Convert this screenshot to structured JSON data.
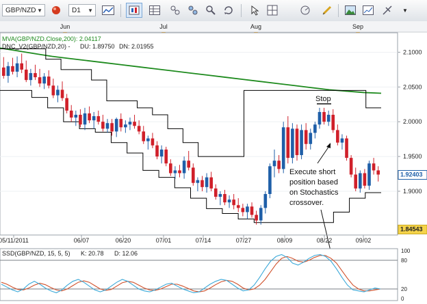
{
  "toolbar": {
    "symbol": "GBP/NZD",
    "timeframe": "D1",
    "icons": [
      "ball-icon",
      "line-chart-icon",
      "chart-type-icon",
      "table-icon",
      "indicators-icon",
      "objects-icon",
      "zoom-icon",
      "refresh-icon",
      "arrow-icon",
      "grid-icon",
      "ruler-icon",
      "image-icon",
      "settings-icon",
      "more-icon"
    ]
  },
  "colors": {
    "background": "#ffffff",
    "bull": "#1f5fa8",
    "bear": "#d0202a",
    "mva": "#1d8a1d",
    "dnc": "#000000",
    "stoch_k": "#3aa8d8",
    "stoch_d": "#d0502a"
  },
  "chart_data": {
    "type": "candlestick",
    "months": [
      "Jun",
      "Jul",
      "Aug",
      "Sep"
    ],
    "legend": {
      "mva": "MVA(GBP/NZD.Close,200): 2.04117",
      "dnc_name": "DNC_V2(GBP/NZD,20) -",
      "dnc_du": "DU: 1.89750",
      "dnc_dn": "DN: 2.01955"
    },
    "price_axis": {
      "ticks": [
        "2.1000",
        "2.0500",
        "2.0000",
        "1.9500",
        "1.9000"
      ],
      "tick_values": [
        2.1,
        2.05,
        2.0,
        1.95,
        1.9
      ],
      "ylim": [
        1.84,
        2.125
      ],
      "last_price": "1.92403",
      "low_price": "1.84543"
    },
    "date_axis": [
      "05/11/2011",
      "06/07",
      "06/20",
      "07/01",
      "07/14",
      "07/27",
      "08/09",
      "08/22",
      "09/02"
    ],
    "annotations": {
      "stop": "Stop",
      "note": [
        "Execute short",
        "position based",
        "on Stochastics",
        "crossover."
      ]
    },
    "stochastic": {
      "legend": "SSD(GBP/NZD, 15, 5, 5)",
      "k": "K: 20.78",
      "d": "D: 12.06",
      "ticks": [
        "100",
        "80",
        "20",
        "0"
      ],
      "tick_values": [
        100,
        80,
        20,
        0
      ],
      "ylim": [
        0,
        100
      ]
    },
    "candles": [
      {
        "o": 2.078,
        "h": 2.093,
        "l": 2.062,
        "c": 2.066
      },
      {
        "o": 2.066,
        "h": 2.086,
        "l": 2.056,
        "c": 2.08
      },
      {
        "o": 2.08,
        "h": 2.092,
        "l": 2.068,
        "c": 2.072
      },
      {
        "o": 2.072,
        "h": 2.094,
        "l": 2.064,
        "c": 2.084
      },
      {
        "o": 2.084,
        "h": 2.098,
        "l": 2.07,
        "c": 2.075
      },
      {
        "o": 2.075,
        "h": 2.088,
        "l": 2.057,
        "c": 2.06
      },
      {
        "o": 2.06,
        "h": 2.076,
        "l": 2.052,
        "c": 2.07
      },
      {
        "o": 2.07,
        "h": 2.082,
        "l": 2.06,
        "c": 2.064
      },
      {
        "o": 2.064,
        "h": 2.076,
        "l": 2.05,
        "c": 2.055
      },
      {
        "o": 2.055,
        "h": 2.07,
        "l": 2.047,
        "c": 2.065
      },
      {
        "o": 2.065,
        "h": 2.074,
        "l": 2.048,
        "c": 2.052
      },
      {
        "o": 2.052,
        "h": 2.062,
        "l": 2.034,
        "c": 2.038
      },
      {
        "o": 2.038,
        "h": 2.052,
        "l": 2.028,
        "c": 2.046
      },
      {
        "o": 2.046,
        "h": 2.058,
        "l": 2.03,
        "c": 2.034
      },
      {
        "o": 2.034,
        "h": 2.04,
        "l": 2.012,
        "c": 2.016
      },
      {
        "o": 2.016,
        "h": 2.024,
        "l": 2.0,
        "c": 2.006
      },
      {
        "o": 2.006,
        "h": 2.016,
        "l": 1.994,
        "c": 2.01
      },
      {
        "o": 2.01,
        "h": 2.018,
        "l": 1.992,
        "c": 1.996
      },
      {
        "o": 1.996,
        "h": 2.02,
        "l": 1.988,
        "c": 2.012
      },
      {
        "o": 2.012,
        "h": 2.022,
        "l": 1.998,
        "c": 2.002
      },
      {
        "o": 2.002,
        "h": 2.014,
        "l": 1.99,
        "c": 2.008
      },
      {
        "o": 2.008,
        "h": 2.016,
        "l": 1.996,
        "c": 2.0
      },
      {
        "o": 2.0,
        "h": 2.01,
        "l": 1.986,
        "c": 1.99
      },
      {
        "o": 1.99,
        "h": 2.004,
        "l": 1.984,
        "c": 1.998
      },
      {
        "o": 1.998,
        "h": 2.004,
        "l": 1.98,
        "c": 1.986
      },
      {
        "o": 1.986,
        "h": 2.006,
        "l": 1.978,
        "c": 2.004
      },
      {
        "o": 2.004,
        "h": 2.012,
        "l": 1.986,
        "c": 1.992
      },
      {
        "o": 1.992,
        "h": 2.002,
        "l": 1.984,
        "c": 1.996
      },
      {
        "o": 1.996,
        "h": 2.006,
        "l": 1.988,
        "c": 2.0
      },
      {
        "o": 2.0,
        "h": 2.01,
        "l": 1.99,
        "c": 1.994
      },
      {
        "o": 1.994,
        "h": 2.002,
        "l": 1.982,
        "c": 1.986
      },
      {
        "o": 1.986,
        "h": 1.994,
        "l": 1.968,
        "c": 1.972
      },
      {
        "o": 1.972,
        "h": 1.98,
        "l": 1.96,
        "c": 1.976
      },
      {
        "o": 1.976,
        "h": 1.984,
        "l": 1.962,
        "c": 1.966
      },
      {
        "o": 1.966,
        "h": 1.972,
        "l": 1.946,
        "c": 1.95
      },
      {
        "o": 1.95,
        "h": 1.966,
        "l": 1.94,
        "c": 1.96
      },
      {
        "o": 1.96,
        "h": 1.964,
        "l": 1.936,
        "c": 1.94
      },
      {
        "o": 1.94,
        "h": 1.946,
        "l": 1.922,
        "c": 1.926
      },
      {
        "o": 1.926,
        "h": 1.936,
        "l": 1.918,
        "c": 1.93
      },
      {
        "o": 1.93,
        "h": 1.938,
        "l": 1.92,
        "c": 1.926
      },
      {
        "o": 1.926,
        "h": 1.95,
        "l": 1.918,
        "c": 1.944
      },
      {
        "o": 1.944,
        "h": 1.958,
        "l": 1.93,
        "c": 1.934
      },
      {
        "o": 1.934,
        "h": 1.94,
        "l": 1.908,
        "c": 1.912
      },
      {
        "o": 1.912,
        "h": 1.92,
        "l": 1.9,
        "c": 1.916
      },
      {
        "o": 1.916,
        "h": 1.922,
        "l": 1.9,
        "c": 1.906
      },
      {
        "o": 1.906,
        "h": 1.926,
        "l": 1.898,
        "c": 1.92
      },
      {
        "o": 1.92,
        "h": 1.928,
        "l": 1.9,
        "c": 1.904
      },
      {
        "o": 1.904,
        "h": 1.91,
        "l": 1.888,
        "c": 1.892
      },
      {
        "o": 1.892,
        "h": 1.9,
        "l": 1.88,
        "c": 1.896
      },
      {
        "o": 1.896,
        "h": 1.902,
        "l": 1.88,
        "c": 1.884
      },
      {
        "o": 1.884,
        "h": 1.894,
        "l": 1.876,
        "c": 1.888
      },
      {
        "o": 1.888,
        "h": 1.896,
        "l": 1.874,
        "c": 1.88
      },
      {
        "o": 1.88,
        "h": 1.89,
        "l": 1.87,
        "c": 1.876
      },
      {
        "o": 1.876,
        "h": 1.882,
        "l": 1.864,
        "c": 1.87
      },
      {
        "o": 1.87,
        "h": 1.882,
        "l": 1.86,
        "c": 1.878
      },
      {
        "o": 1.878,
        "h": 1.884,
        "l": 1.862,
        "c": 1.866
      },
      {
        "o": 1.866,
        "h": 1.872,
        "l": 1.852,
        "c": 1.858
      },
      {
        "o": 1.858,
        "h": 1.88,
        "l": 1.852,
        "c": 1.876
      },
      {
        "o": 1.876,
        "h": 1.9,
        "l": 1.868,
        "c": 1.896
      },
      {
        "o": 1.896,
        "h": 1.94,
        "l": 1.89,
        "c": 1.936
      },
      {
        "o": 1.936,
        "h": 1.96,
        "l": 1.92,
        "c": 1.944
      },
      {
        "o": 1.944,
        "h": 1.952,
        "l": 1.926,
        "c": 1.932
      },
      {
        "o": 1.932,
        "h": 2.0,
        "l": 1.926,
        "c": 1.992
      },
      {
        "o": 1.992,
        "h": 2.008,
        "l": 1.94,
        "c": 1.948
      },
      {
        "o": 1.948,
        "h": 1.998,
        "l": 1.94,
        "c": 1.99
      },
      {
        "o": 1.99,
        "h": 1.996,
        "l": 1.944,
        "c": 1.952
      },
      {
        "o": 1.952,
        "h": 1.996,
        "l": 1.946,
        "c": 1.988
      },
      {
        "o": 1.988,
        "h": 1.998,
        "l": 1.96,
        "c": 1.968
      },
      {
        "o": 1.968,
        "h": 1.99,
        "l": 1.96,
        "c": 1.984
      },
      {
        "o": 1.984,
        "h": 2.0,
        "l": 1.976,
        "c": 1.996
      },
      {
        "o": 1.996,
        "h": 2.02,
        "l": 1.99,
        "c": 2.014
      },
      {
        "o": 2.014,
        "h": 2.02,
        "l": 1.996,
        "c": 2.0
      },
      {
        "o": 2.0,
        "h": 2.016,
        "l": 1.994,
        "c": 2.01
      },
      {
        "o": 2.01,
        "h": 2.018,
        "l": 1.984,
        "c": 1.988
      },
      {
        "o": 1.988,
        "h": 1.996,
        "l": 1.966,
        "c": 1.97
      },
      {
        "o": 1.97,
        "h": 1.982,
        "l": 1.96,
        "c": 1.976
      },
      {
        "o": 1.976,
        "h": 1.98,
        "l": 1.944,
        "c": 1.948
      },
      {
        "o": 1.948,
        "h": 1.952,
        "l": 1.92,
        "c": 1.924
      },
      {
        "o": 1.924,
        "h": 1.934,
        "l": 1.9,
        "c": 1.904
      },
      {
        "o": 1.904,
        "h": 1.93,
        "l": 1.898,
        "c": 1.926
      },
      {
        "o": 1.926,
        "h": 1.932,
        "l": 1.904,
        "c": 1.908
      },
      {
        "o": 1.908,
        "h": 1.944,
        "l": 1.902,
        "c": 1.94
      },
      {
        "o": 1.94,
        "h": 1.948,
        "l": 1.924,
        "c": 1.93
      },
      {
        "o": 1.93,
        "h": 1.936,
        "l": 1.914,
        "c": 1.924
      }
    ],
    "mva_values": [
      2.106,
      2.102,
      2.098,
      2.094,
      2.091,
      2.088,
      2.085,
      2.082,
      2.079,
      2.076,
      2.073,
      2.07,
      2.067,
      2.064,
      2.061,
      2.058,
      2.055,
      2.052,
      2.049,
      2.046,
      2.044,
      2.042,
      2.041
    ],
    "dnc_upper": [
      2.105,
      2.105,
      2.105,
      2.09,
      2.075,
      2.075,
      2.06,
      2.03,
      2.03,
      2.02,
      2.01,
      1.99,
      1.97,
      1.95,
      1.95,
      1.95,
      2.045,
      2.045,
      2.045,
      2.045,
      2.045,
      2.045,
      2.045,
      2.045,
      2.02,
      2.02
    ],
    "dnc_lower": [
      2.045,
      2.045,
      2.035,
      2.02,
      2.0,
      1.99,
      1.985,
      1.97,
      1.955,
      1.93,
      1.92,
      1.905,
      1.89,
      1.875,
      1.868,
      1.86,
      1.855,
      1.855,
      1.855,
      1.855,
      1.855,
      1.87,
      1.89,
      1.898,
      1.898
    ],
    "stoch_k_values": [
      30,
      24,
      18,
      14,
      20,
      30,
      36,
      30,
      22,
      16,
      12,
      18,
      28,
      36,
      40,
      34,
      26,
      18,
      14,
      18,
      26,
      34,
      40,
      36,
      28,
      20,
      16,
      14,
      18,
      24,
      30,
      32,
      26,
      20,
      16,
      12,
      14,
      22,
      30,
      36,
      40,
      38,
      30,
      22,
      16,
      18,
      28,
      44,
      62,
      78,
      88,
      92,
      86,
      74,
      70,
      76,
      84,
      90,
      92,
      88,
      78,
      62,
      44,
      28,
      18,
      16,
      14,
      18,
      22,
      20
    ],
    "stoch_d_values": [
      34,
      30,
      24,
      19,
      18,
      22,
      28,
      32,
      29,
      23,
      18,
      16,
      20,
      27,
      34,
      37,
      34,
      27,
      20,
      17,
      19,
      26,
      33,
      36,
      34,
      28,
      22,
      18,
      17,
      20,
      25,
      30,
      30,
      26,
      21,
      16,
      14,
      16,
      22,
      29,
      35,
      38,
      36,
      30,
      22,
      18,
      20,
      28,
      40,
      56,
      72,
      84,
      88,
      84,
      78,
      76,
      80,
      86,
      90,
      90,
      84,
      74,
      58,
      42,
      28,
      20,
      16,
      16,
      18,
      20
    ]
  }
}
